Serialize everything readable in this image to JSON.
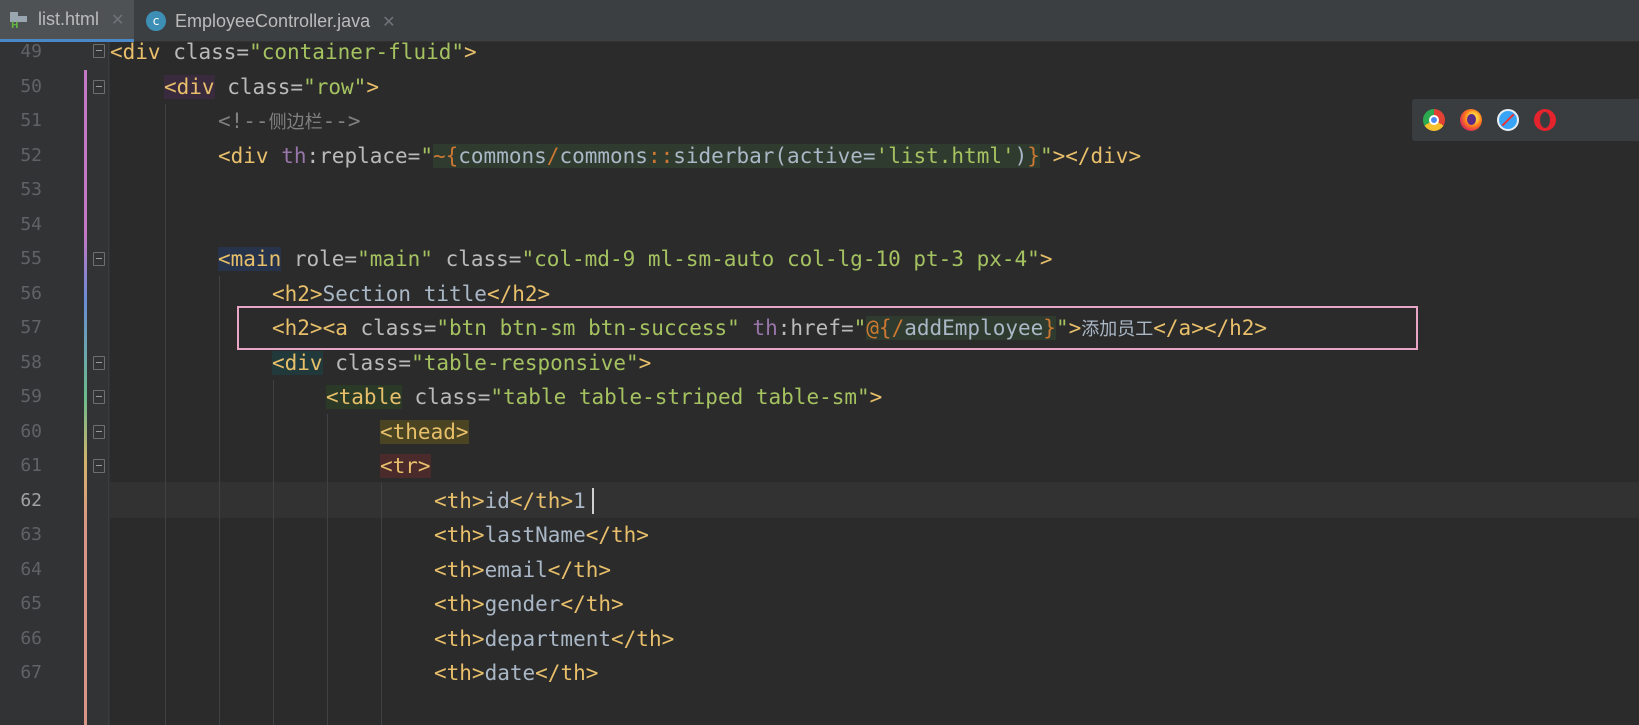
{
  "tabs": [
    {
      "label": "list.html",
      "icon": "html-file-icon",
      "active": true
    },
    {
      "label": "EmployeeController.java",
      "icon": "java-class-icon",
      "active": false
    }
  ],
  "browsers": [
    "chrome-icon",
    "firefox-icon",
    "safari-icon",
    "opera-icon"
  ],
  "gutter": {
    "line_numbers": [
      "49",
      "50",
      "51",
      "52",
      "53",
      "54",
      "55",
      "56",
      "57",
      "58",
      "59",
      "60",
      "61",
      "62",
      "63",
      "64",
      "65",
      "66",
      "67"
    ],
    "current_line": "62"
  },
  "code": {
    "l49": {
      "open": "<div",
      "attr": " class=",
      "val": "\"container-fluid\"",
      "close": ">"
    },
    "l50": {
      "open": "<div",
      "attr": " class=",
      "val": "\"row\"",
      "close": ">"
    },
    "l51": {
      "comment_open": "<!--",
      "comment_text": "侧边栏",
      "comment_close": "-->"
    },
    "l52": {
      "open": "<div",
      "ns": " th",
      "attr": ":replace=",
      "q1": "\"",
      "e1": "~{",
      "e2": "commons",
      "e3": "/",
      "e4": "commons",
      "e5": "::",
      "e6": "siderbar(active=",
      "e7": "'list.html'",
      "e8": ")",
      "e9": "}",
      "q2": "\"",
      "close": "></div>"
    },
    "l55": {
      "open": "<main",
      "attr1": " role=",
      "val1": "\"main\"",
      "attr2": " class=",
      "val2": "\"col-md-9 ml-sm-auto col-lg-10 pt-3 px-4\"",
      "close": ">"
    },
    "l56": {
      "open": "<h2>",
      "text": "Section title",
      "close": "</h2>"
    },
    "l57": {
      "open": "<h2><a",
      "attr": " class=",
      "val": "\"btn btn-sm btn-success\"",
      "ns": " th",
      "attr2": ":href=",
      "q1": "\"",
      "e1": "@{",
      "e2": "/",
      "e3": "addEmployee",
      "e4": "}",
      "q2": "\"",
      "gt": ">",
      "text": "添加员工",
      "close": "</a></h2>"
    },
    "l58": {
      "open": "<div",
      "attr": " class=",
      "val": "\"table-responsive\"",
      "close": ">"
    },
    "l59": {
      "open": "<table",
      "attr": " class=",
      "val": "\"table table-striped table-sm\"",
      "close": ">"
    },
    "l60": {
      "tag": "<thead>"
    },
    "l61": {
      "tag": "<tr>"
    },
    "l62": {
      "open": "<th>",
      "text": "id",
      "close": "</th>",
      "tail": "1"
    },
    "l63": {
      "open": "<th>",
      "text": "lastName",
      "close": "</th>"
    },
    "l64": {
      "open": "<th>",
      "text": "email",
      "close": "</th>"
    },
    "l65": {
      "open": "<th>",
      "text": "gender",
      "close": "</th>"
    },
    "l66": {
      "open": "<th>",
      "text": "department",
      "close": "</th>"
    },
    "l67": {
      "open": "<th>",
      "text": "date",
      "close": "</th>"
    }
  }
}
